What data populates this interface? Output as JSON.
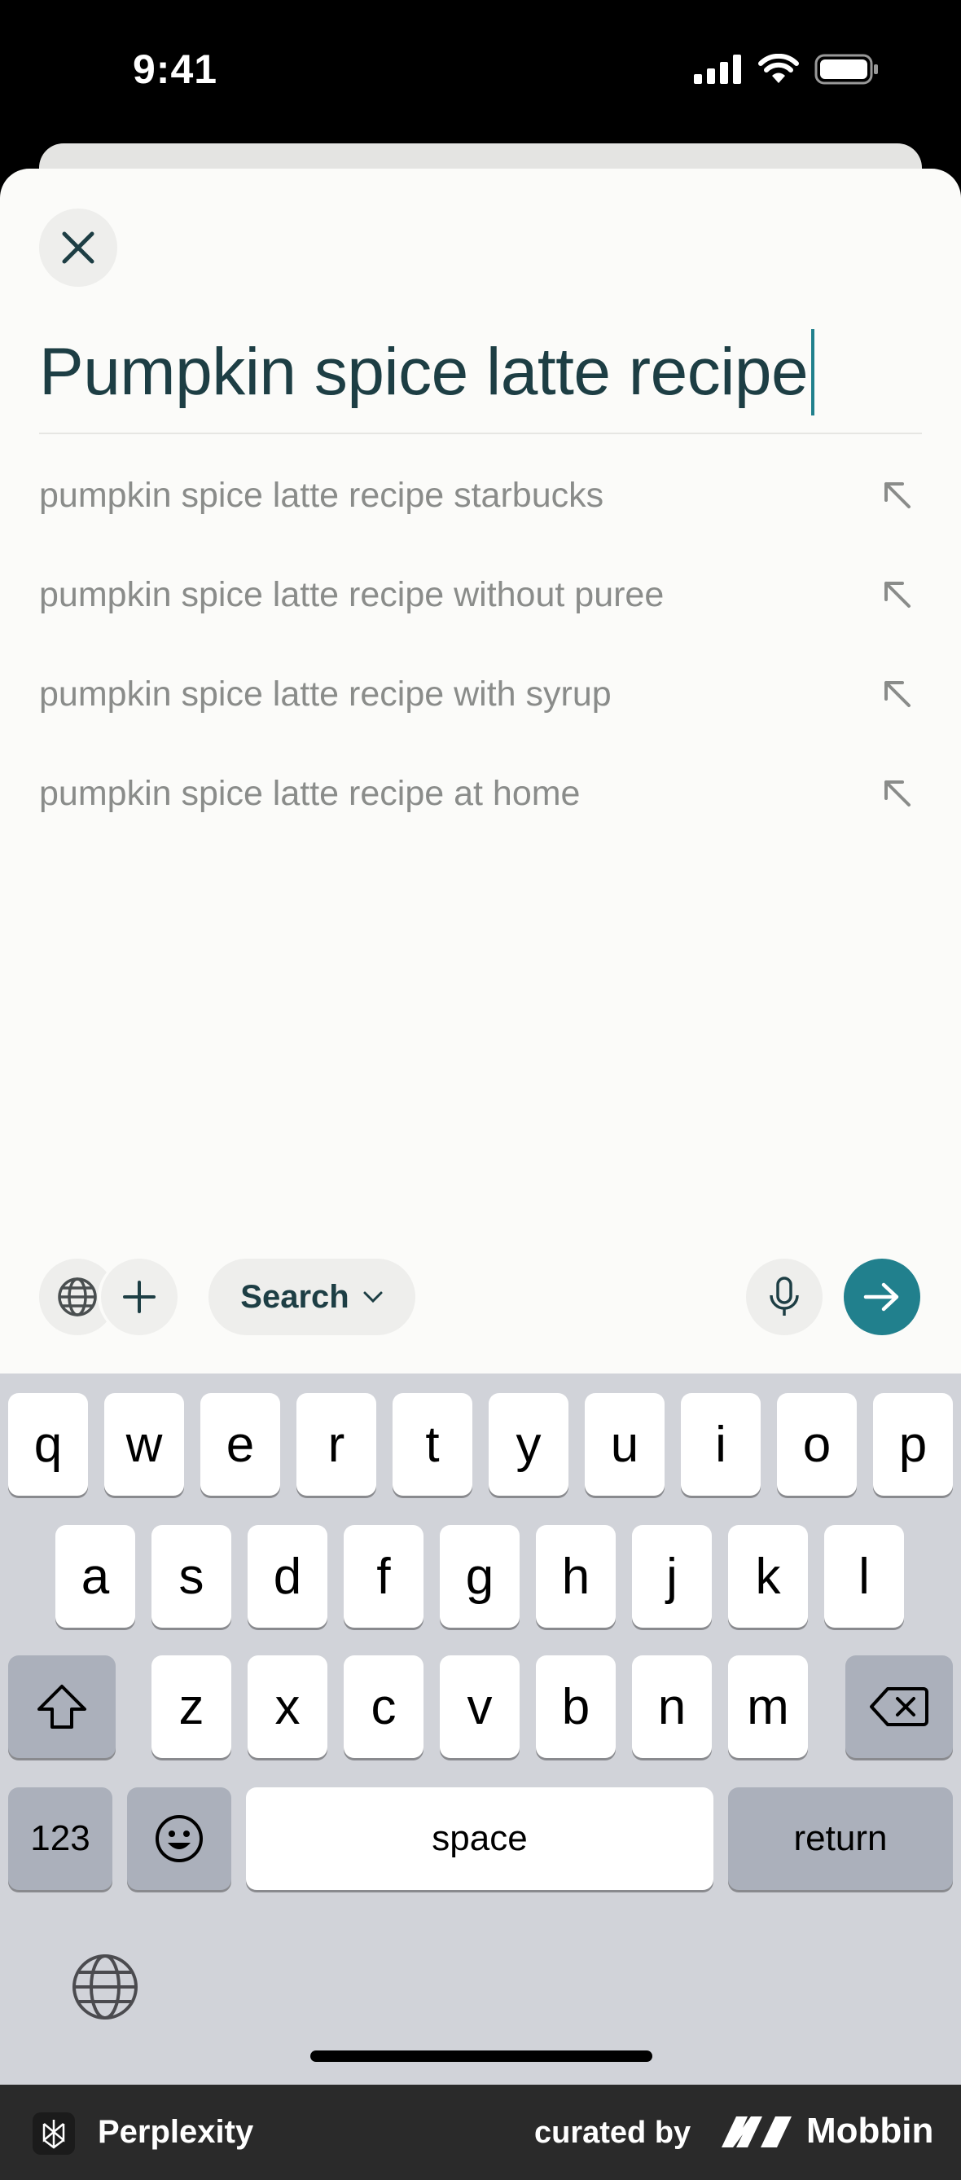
{
  "status_bar": {
    "time": "9:41"
  },
  "search": {
    "query": "Pumpkin spice latte recipe"
  },
  "suggestions": [
    "pumpkin spice latte recipe starbucks",
    "pumpkin spice latte recipe without puree",
    "pumpkin spice latte recipe with syrup",
    "pumpkin spice latte recipe at home"
  ],
  "toolbar": {
    "mode_label": "Search"
  },
  "keyboard": {
    "row1": [
      "q",
      "w",
      "e",
      "r",
      "t",
      "y",
      "u",
      "i",
      "o",
      "p"
    ],
    "row2": [
      "a",
      "s",
      "d",
      "f",
      "g",
      "h",
      "j",
      "k",
      "l"
    ],
    "row3": [
      "z",
      "x",
      "c",
      "v",
      "b",
      "n",
      "m"
    ],
    "numbers_label": "123",
    "space_label": "space",
    "return_label": "return"
  },
  "footer": {
    "app_name": "Perplexity",
    "curated_by": "curated by",
    "brand": "Mobbin"
  },
  "colors": {
    "accent": "#21808d",
    "query_text": "#1d3e44",
    "suggestion_text": "#8a8c8a"
  }
}
